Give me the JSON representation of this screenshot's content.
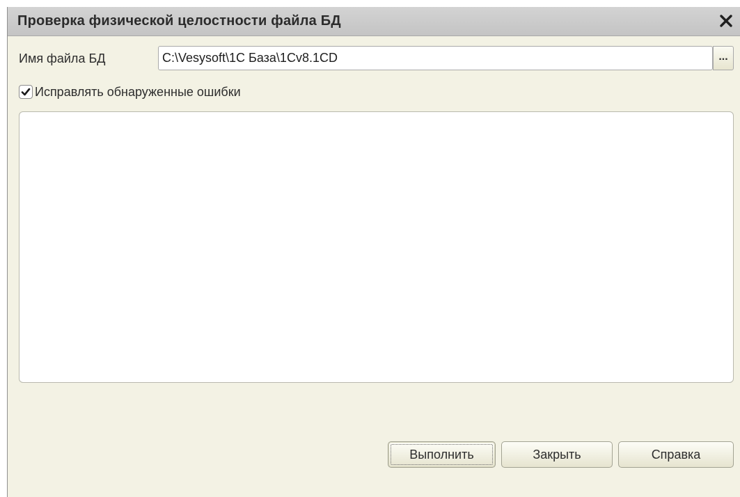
{
  "window": {
    "title": "Проверка физической целостности файла БД",
    "close_symbol": "✕"
  },
  "file": {
    "label": "Имя файла БД",
    "value": "C:\\Vesysoft\\1C База\\1Cv8.1CD",
    "browse_label": "..."
  },
  "options": {
    "fix_errors_label": "Исправлять обнаруженные ошибки",
    "fix_errors_checked": true
  },
  "log": {
    "content": ""
  },
  "buttons": {
    "run": "Выполнить",
    "close": "Закрыть",
    "help": "Справка"
  },
  "icons": {
    "close": "close-icon",
    "check": "checkmark-icon"
  }
}
